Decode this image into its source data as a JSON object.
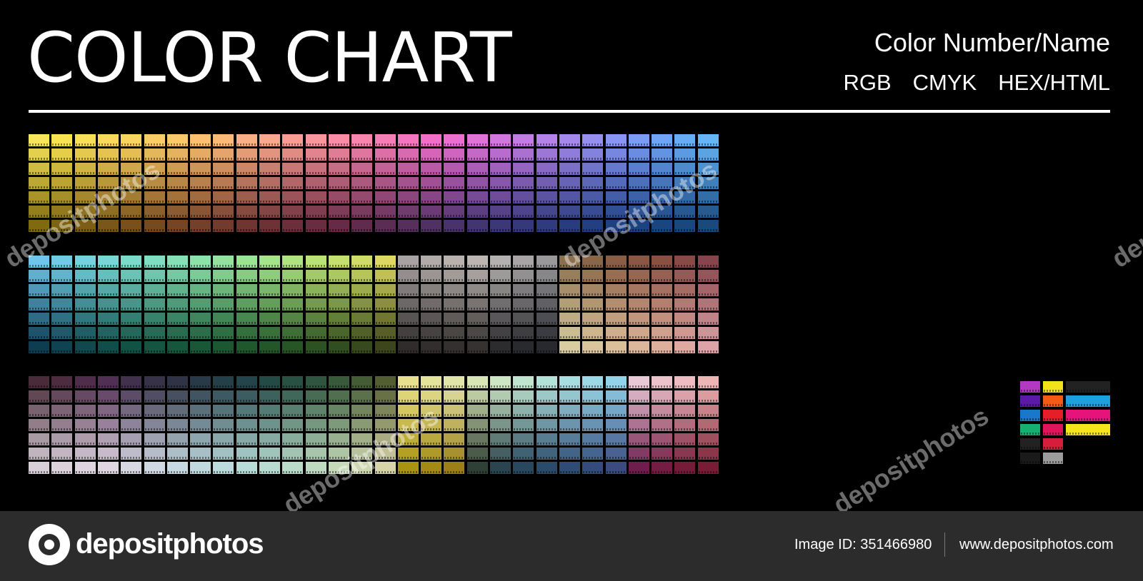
{
  "header": {
    "title": "COLOR CHART",
    "legend_line1": "Color Number/Name",
    "legend_items": [
      "RGB",
      "CMYK",
      "HEX/HTML"
    ]
  },
  "footer": {
    "brand": "depositphotos",
    "image_id": "Image ID: 351466980",
    "url": "www.depositphotos.com"
  },
  "watermark_text": "depositphotos",
  "colors": {
    "background": "#000000",
    "footer_background": "#2c2c2c",
    "text": "#ffffff"
  },
  "palette": {
    "block1_row_top": [
      "#f7e65a",
      "#f8e451",
      "#f8df58",
      "#f9d85c",
      "#fad460",
      "#fbcd66",
      "#fbc86a",
      "#fcc070",
      "#fcb978",
      "#fab084",
      "#f9a78d",
      "#f99d94",
      "#f9959c",
      "#f88da5",
      "#f785ae",
      "#f67db6",
      "#f476bf",
      "#f16fc8",
      "#ea6fd0",
      "#df73d8",
      "#d177de",
      "#c37ce3",
      "#b482e8",
      "#a588ec",
      "#968ff0",
      "#8895f3",
      "#7b9cf5",
      "#70a4f6",
      "#69acf6",
      "#68b5f5"
    ],
    "block1_row_bottom": [
      "#7f6a0f",
      "#7d6413",
      "#7b5d17",
      "#79571a",
      "#77501d",
      "#764a21",
      "#754525",
      "#734029",
      "#713b2d",
      "#6f3631",
      "#6c3236",
      "#6a2f3b",
      "#672d41",
      "#642c47",
      "#602c4e",
      "#5b2d55",
      "#562f5c",
      "#503164",
      "#4a336a",
      "#433570",
      "#3c3775",
      "#353979",
      "#2f3b7c",
      "#293d7e",
      "#243f80",
      "#204180",
      "#1d437f",
      "#1b457e",
      "#1a477c",
      "#1a497a"
    ],
    "block2_row_top": [
      "#70c6ea",
      "#72cbe4",
      "#75d1dd",
      "#78d6d4",
      "#7cdacb",
      "#81ddc1",
      "#86e0b6",
      "#8ce2ab",
      "#93e39f",
      "#9be494",
      "#a4e48a",
      "#aee480",
      "#b9e277",
      "#c4e06f",
      "#d0dc68",
      "#dcd862",
      "#a8a3a2",
      "#b0aaa8",
      "#b8b1ae",
      "#bcb5b2",
      "#b4b0b0",
      "#a8a4a6",
      "#9a989b",
      "#8b6f4d",
      "#8a6648",
      "#8a5e45",
      "#895743",
      "#885043",
      "#874a46",
      "#86454c"
    ],
    "block2_row_bottom": [
      "#0e3d52",
      "#0f4351",
      "#10484e",
      "#114d4a",
      "#125146",
      "#145441",
      "#16563c",
      "#185837",
      "#1b5832",
      "#1f582d",
      "#235729",
      "#275526",
      "#2c5223",
      "#314e20",
      "#364a1e",
      "#3c451c",
      "#302c2b",
      "#322e2d",
      "#34302f",
      "#363231",
      "#2c2b2d",
      "#292a2e",
      "#27292f",
      "#d8cca0",
      "#dac59c",
      "#dbbe9a",
      "#dcb79a",
      "#ddb09c",
      "#dda9a0",
      "#dca4a6"
    ],
    "block3_row_top": [
      "#4a2b3a",
      "#4d2c42",
      "#4f2d4a",
      "#512e53",
      "#43304e",
      "#383249",
      "#2e3446",
      "#283a47",
      "#243f48",
      "#22444a",
      "#244a47",
      "#285043",
      "#2f553f",
      "#38593a",
      "#445c36",
      "#525d32",
      "#e8e08c",
      "#e6e39a",
      "#e1e5a8",
      "#d8e6b6",
      "#cde6c3",
      "#c0e5cf",
      "#b3e2d9",
      "#a7dee1",
      "#9cd9e7",
      "#93d3ea",
      "#e9c9d6",
      "#ecc3cb",
      "#eebcc0",
      "#eeb5b5"
    ],
    "block3_row_bottom": [
      "#d8d0d8",
      "#dbd2dc",
      "#ddd4df",
      "#dfd6e2",
      "#d7d7e3",
      "#cfd8e3",
      "#c7d9e2",
      "#c0dae0",
      "#bbdbdc",
      "#b8dcd7",
      "#b8dcd1",
      "#badcc9",
      "#bfdbc1",
      "#c6dab9",
      "#cfd7b1",
      "#d8d4aa",
      "#a8940f",
      "#a38a12",
      "#9c7f16",
      "#2f4036",
      "#2a4450",
      "#28485f",
      "#2a4b6c",
      "#2e4c76",
      "#344c7d",
      "#3b4b80",
      "#6f1d4d",
      "#731c44",
      "#761c3b",
      "#781d33"
    ],
    "special": {
      "col1": [
        "#b23ac2",
        "#5a1aa6",
        "#1a78cc",
        "#18b070",
        "#222222",
        "#1a1a1a"
      ],
      "col2": [
        "#f2e21a",
        "#f25a16",
        "#e61e28",
        "#e0145a",
        "#d61e3a",
        "#9c9c9c"
      ],
      "bars": [
        "#222222",
        "#1ea0dc",
        "#e6147a",
        "#f5e61a"
      ]
    }
  }
}
